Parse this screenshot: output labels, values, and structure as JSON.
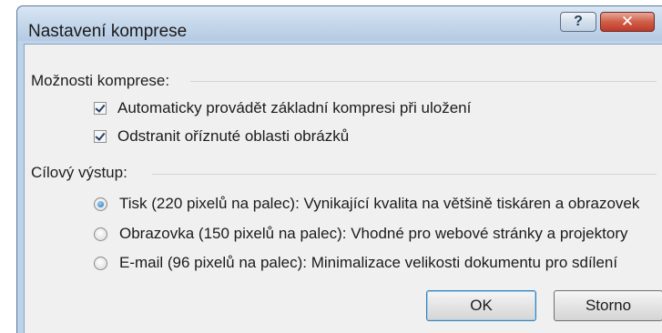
{
  "dialog": {
    "title": "Nastavení komprese",
    "help_glyph": "?",
    "close_glyph": "✕"
  },
  "compression_options": {
    "label": "Možnosti komprese:",
    "items": [
      {
        "label": "Automaticky provádět základní kompresi při uložení",
        "checked": true
      },
      {
        "label": "Odstranit oříznuté oblasti obrázků",
        "checked": true
      }
    ]
  },
  "target_output": {
    "label": "Cílový výstup:",
    "options": [
      {
        "label": "Tisk (220 pixelů na palec): Vynikající kvalita na většině tiskáren a obrazovek",
        "selected": true
      },
      {
        "label": "Obrazovka (150 pixelů na palec): Vhodné pro webové stránky a projektory",
        "selected": false
      },
      {
        "label": "E-mail (96 pixelů na palec): Minimalizace velikosti dokumentu pro sdílení",
        "selected": false
      }
    ]
  },
  "buttons": {
    "ok_label": "OK",
    "cancel_label": "Storno"
  }
}
